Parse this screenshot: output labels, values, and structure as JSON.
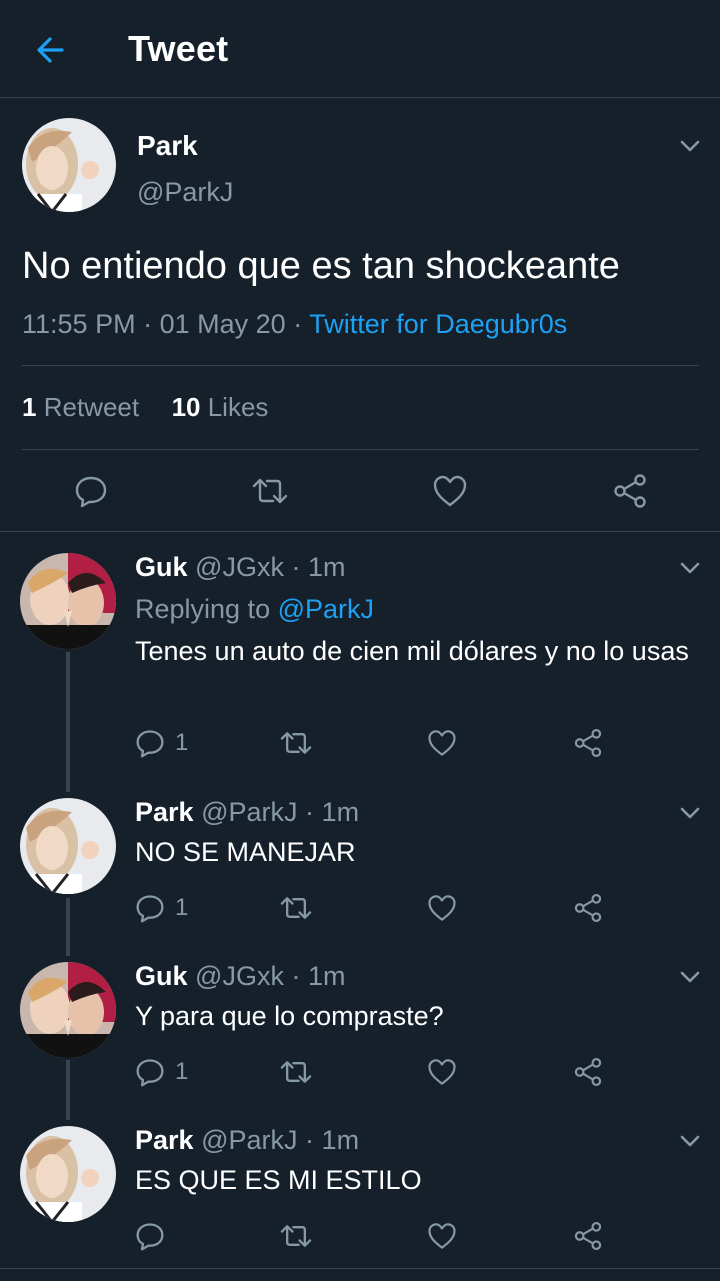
{
  "header": {
    "title": "Tweet",
    "back_icon": "arrow-left-icon",
    "accent": "#1da1f2"
  },
  "main_tweet": {
    "name": "Park",
    "handle": "@ParkJ",
    "text": "No entiendo que es tan shockeante",
    "time": "11:55 PM",
    "date": "01 May 20",
    "source": "Twitter for Daegubr0s",
    "retweet_count": "1",
    "retweet_label": "Retweet",
    "like_count": "10",
    "like_label": "Likes",
    "action_icons": [
      "reply-icon",
      "retweet-icon",
      "like-icon",
      "share-icon"
    ]
  },
  "replies": [
    {
      "name": "Guk",
      "handle": "@JGxk",
      "time": "1m",
      "replying_prefix": "Replying to",
      "replying_to": "@ParkJ",
      "text": "Tenes un auto de cien mil dólares y no lo usas",
      "reply_count": "1"
    },
    {
      "name": "Park",
      "handle": "@ParkJ",
      "time": "1m",
      "text": "NO SE MANEJAR",
      "reply_count": "1"
    },
    {
      "name": "Guk",
      "handle": "@JGxk",
      "time": "1m",
      "text": "Y para que lo compraste?",
      "reply_count": "1"
    },
    {
      "name": "Park",
      "handle": "@ParkJ",
      "time": "1m",
      "text": "ES QUE ES MI ESTILO",
      "reply_count": ""
    }
  ],
  "colors": {
    "background": "#15202b",
    "border": "#38444d",
    "secondary_text": "#8899a6",
    "link": "#1da1f2"
  }
}
